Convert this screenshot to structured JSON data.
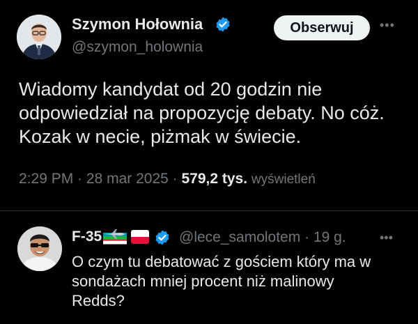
{
  "main_tweet": {
    "author_name": "Szymon Hołownia",
    "handle": "@szymon_holownia",
    "follow_label": "Obserwuj",
    "more_label": "•••",
    "text_lines": [
      "Wiadomy kandydat od 20 godzin nie",
      "odpowiedział na propozycję debaty. No cóż.",
      "Kozak w necie, piżmak w świecie."
    ],
    "time": "2:29 PM",
    "date": "28 mar 2025",
    "views_count": "579,2 tys.",
    "views_label": "wyświetleń"
  },
  "reply": {
    "author_name": "F-35",
    "handle": "@lece_samolotem",
    "age": "19 g.",
    "more_label": "•••",
    "text_lines": [
      "O czym tu debatować z gościem który ma w",
      "sondażach mniej procent niż malinowy",
      "Redds?"
    ]
  },
  "colors": {
    "background": "#000000",
    "text": "#e7e9ea",
    "muted": "#71767b",
    "verified": "#1d9bf0",
    "follow_bg": "#eff3f4"
  },
  "icons": {
    "verified": "verified-badge-icon",
    "more": "more-dots-icon",
    "plane_flag": "jet-flag-icon",
    "poland_flag": "poland-flag-icon"
  }
}
